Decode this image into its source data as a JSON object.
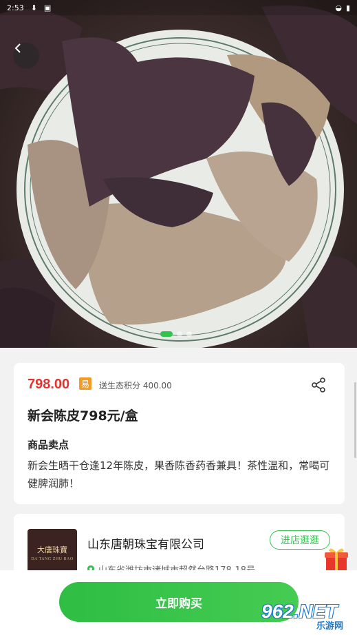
{
  "status_bar": {
    "time": "2:53",
    "icons": [
      "download-icon",
      "notification-icon",
      "wifi-icon",
      "battery-icon"
    ]
  },
  "hero": {
    "pagination": {
      "count": 3,
      "active": 0
    }
  },
  "product": {
    "price": "798.00",
    "badge": "易",
    "eco_points": "送生态积分 400.00",
    "title": "新会陈皮798元/盒",
    "selling_points_heading": "商品卖点",
    "selling_points_text": "新会生晒干仓逢12年陈皮，果香陈香药香兼具！茶性温和，常喝可健脾润肺！"
  },
  "store": {
    "logo_cn": "大唐珠寶",
    "logo_en": "DA TANG ZHU BAO",
    "name": "山东唐朝珠宝有限公司",
    "visit_label": "进店逛逛",
    "address": "山东省潍坊市诸城市超然台路178-18号"
  },
  "bottom": {
    "buy_label": "立即购买",
    "watermark_main": "962.NET",
    "watermark_sub": "乐游网"
  },
  "colors": {
    "accent": "#33c24d",
    "price": "#e4312d",
    "badge": "#f59a23"
  }
}
